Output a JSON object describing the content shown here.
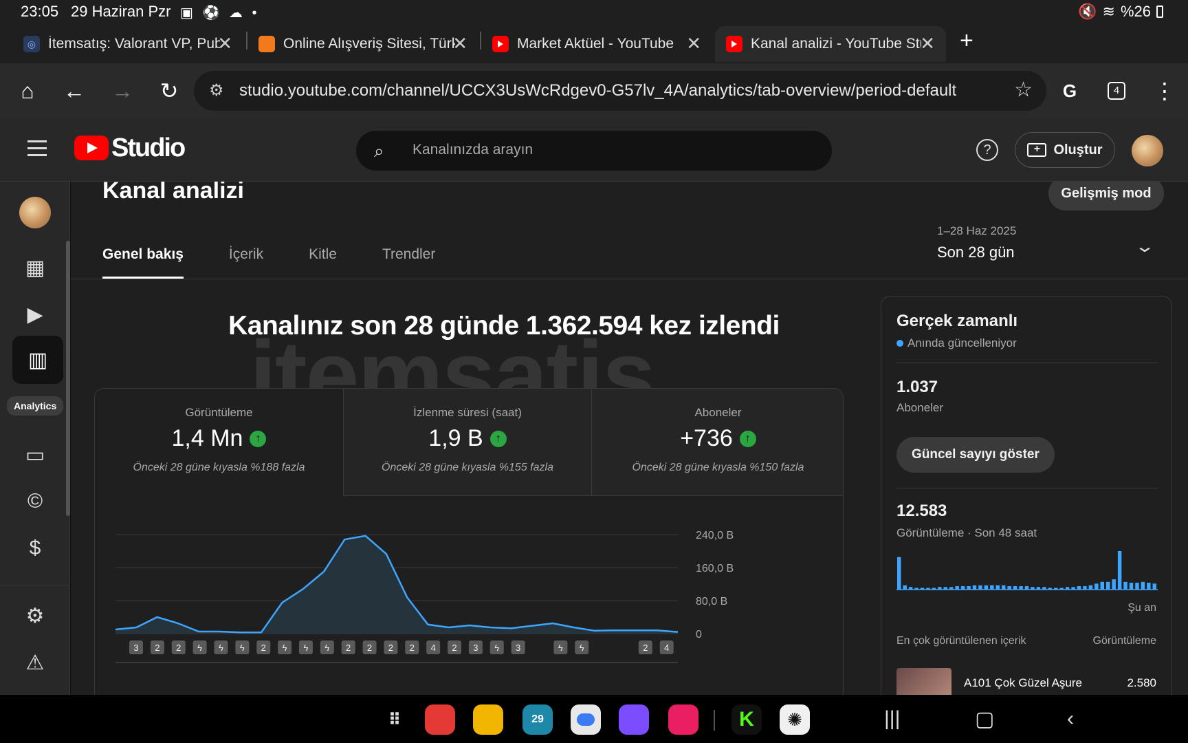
{
  "status": {
    "time": "23:05",
    "date": "29 Haziran Pzr",
    "battery": "%26"
  },
  "browser": {
    "tabs": [
      {
        "title": "İtemsatış: Valorant VP, Pubg",
        "favicon": "itemsatis-icon",
        "active": false
      },
      {
        "title": "Online Alışveriş Sitesi, Türkiye",
        "favicon": "shop-icon",
        "active": false
      },
      {
        "title": "Market Aktüel - YouTube",
        "favicon": "youtube-icon",
        "active": false
      },
      {
        "title": "Kanal analizi - YouTube Studio",
        "favicon": "youtube-icon",
        "active": true
      }
    ],
    "url": "studio.youtube.com/channel/UCCX3UsWcRdgev0-G57lv_4A/analytics/tab-overview/period-default",
    "tab_count": "4"
  },
  "studio": {
    "brand": "Studio",
    "search_placeholder": "Kanalınızda arayın",
    "create_label": "Oluştur",
    "rail_tooltip": "Analytics"
  },
  "page": {
    "title": "Kanal analizi",
    "advanced_mode": "Gelişmiş mod",
    "tabs": [
      "Genel bakış",
      "İçerik",
      "Kitle",
      "Trendler"
    ],
    "period_range": "1–28 Haz 2025",
    "period_label": "Son 28 gün",
    "headline": "Kanalınız son 28 günde 1.362.594 kez izlendi",
    "watermark": "itemsatis",
    "metrics": [
      {
        "title": "Görüntüleme",
        "value": "1,4 Mn",
        "compare": "Önceki 28 güne kıyasla %188 fazla"
      },
      {
        "title": "İzlenme süresi (saat)",
        "value": "1,9 B",
        "compare": "Önceki 28 güne kıyasla %155 fazla"
      },
      {
        "title": "Aboneler",
        "value": "+736",
        "compare": "Önceki 28 güne kıyasla %150 fazla"
      }
    ]
  },
  "chart_data": {
    "type": "area",
    "ylim": [
      0,
      240000
    ],
    "yticks": [
      "240,0 B",
      "160,0 B",
      "80,0 B",
      "0"
    ],
    "values": [
      10000,
      15000,
      40000,
      25000,
      5000,
      5000,
      3000,
      3000,
      75000,
      108000,
      150000,
      228000,
      237000,
      193000,
      88000,
      22000,
      15000,
      20000,
      15000,
      13000,
      19000,
      25000,
      15000,
      7000,
      8000,
      8000,
      8000,
      4000
    ],
    "markers": [
      "3",
      "2",
      "2",
      "shorts",
      "shorts",
      "shorts",
      "2",
      "shorts",
      "shorts",
      "shorts",
      "2",
      "2",
      "2",
      "2",
      "4",
      "2",
      "3",
      "shorts",
      "3",
      "",
      "shorts",
      "shorts",
      "",
      "",
      "2",
      "4"
    ],
    "colors": {
      "line": "#3ea6ff",
      "fill": "#263540"
    }
  },
  "realtime": {
    "title": "Gerçek zamanlı",
    "subtitle": "Anında güncelleniyor",
    "subs_value": "1.037",
    "subs_label": "Aboneler",
    "show_count": "Güncel sayıyı göster",
    "views_value": "12.583",
    "views_label": "Görüntüleme · Son 48 saat",
    "now_label": "Şu an",
    "top_header_left": "En çok görüntülenen içerik",
    "top_header_right": "Görüntüleme",
    "top_item_title": "A101 Çok Güzel Aşure",
    "top_item_views": "2.580",
    "mini_bars": [
      38,
      5,
      3,
      2,
      2,
      2,
      2,
      3,
      3,
      3,
      4,
      4,
      4,
      5,
      5,
      5,
      5,
      5,
      5,
      4,
      4,
      4,
      4,
      3,
      3,
      3,
      2,
      2,
      2,
      3,
      3,
      4,
      4,
      5,
      7,
      9,
      9,
      12,
      45,
      9,
      8,
      8,
      9,
      8,
      7
    ]
  }
}
